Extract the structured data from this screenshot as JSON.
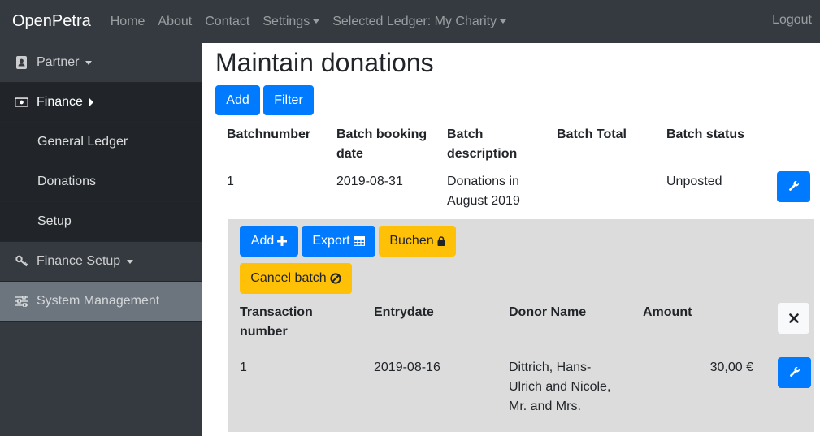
{
  "navbar": {
    "brand": "OpenPetra",
    "links": [
      "Home",
      "About",
      "Contact"
    ],
    "settings": "Settings",
    "ledger": "Selected Ledger: My Charity",
    "logout": "Logout"
  },
  "sidebar": {
    "partner": "Partner",
    "finance": "Finance",
    "general_ledger": "General Ledger",
    "donations": "Donations",
    "setup": "Setup",
    "finance_setup": "Finance Setup",
    "system_management": "System Management"
  },
  "page": {
    "title": "Maintain donations",
    "add": "Add",
    "filter": "Filter"
  },
  "batch_table": {
    "headers": [
      "Batchnumber",
      "Batch booking date",
      "Batch description",
      "Batch Total",
      "Batch status"
    ],
    "row": {
      "number": "1",
      "date": "2019-08-31",
      "description": "Donations in August 2019",
      "total": "",
      "status": "Unposted"
    }
  },
  "batch_detail": {
    "add": "Add",
    "export": "Export",
    "buchen": "Buchen",
    "cancel_batch": "Cancel batch",
    "headers": [
      "Transaction number",
      "Entrydate",
      "Donor Name",
      "Amount"
    ],
    "row": {
      "number": "1",
      "date": "2019-08-16",
      "donor": "Dittrich, Hans-Ulrich and Nicole, Mr. and Mrs.",
      "amount": "30,00 €"
    }
  },
  "colors": {
    "navbar": "#343a40",
    "primary": "#007bff",
    "warning": "#ffc107",
    "panel": "#dcdcdc"
  }
}
